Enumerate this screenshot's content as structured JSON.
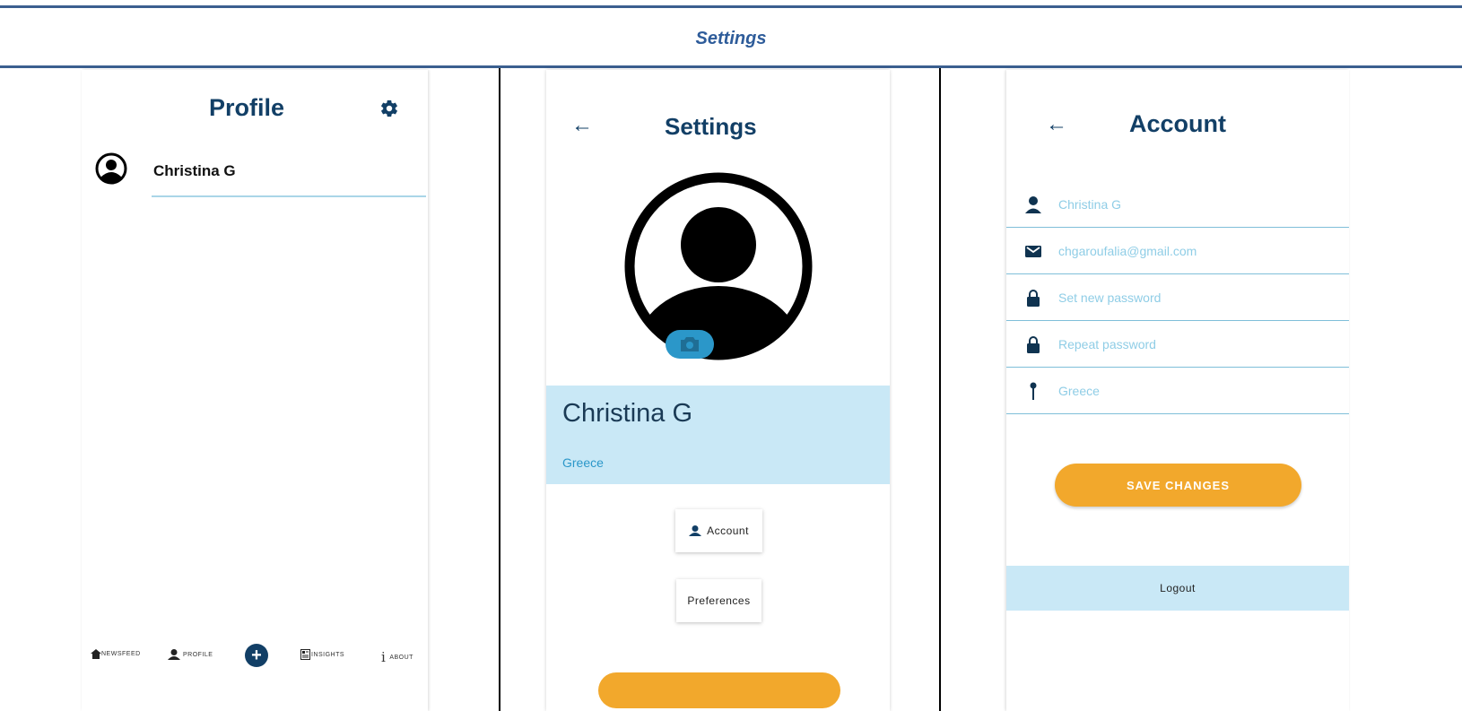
{
  "header": {
    "title": "Settings"
  },
  "profile_screen": {
    "title": "Profile",
    "user_name": "Christina G",
    "nav": {
      "newsfeed": "NEWSFEED",
      "profile": "PROFILE",
      "add": "+",
      "insights": "INSIGHTS",
      "about": "ABOUT"
    }
  },
  "settings_screen": {
    "back": "←",
    "title": "Settings",
    "user_name": "Christina G",
    "country": "Greece",
    "account_button": "Account",
    "preferences_button": "Preferences"
  },
  "account_screen": {
    "back": "←",
    "title": "Account",
    "fields": {
      "name_placeholder": "Christina G",
      "email_placeholder": "chgaroufalia@gmail.com",
      "new_password_placeholder": "Set new password",
      "repeat_password_placeholder": "Repeat password",
      "location_placeholder": "Greece"
    },
    "save_button": "SAVE CHANGES",
    "logout": "Logout"
  },
  "colors": {
    "primary": "#123f66",
    "accent": "#2b97c9",
    "band": "#c9e8f6",
    "orange": "#f2a82c",
    "rule": "#3b5f8f"
  }
}
